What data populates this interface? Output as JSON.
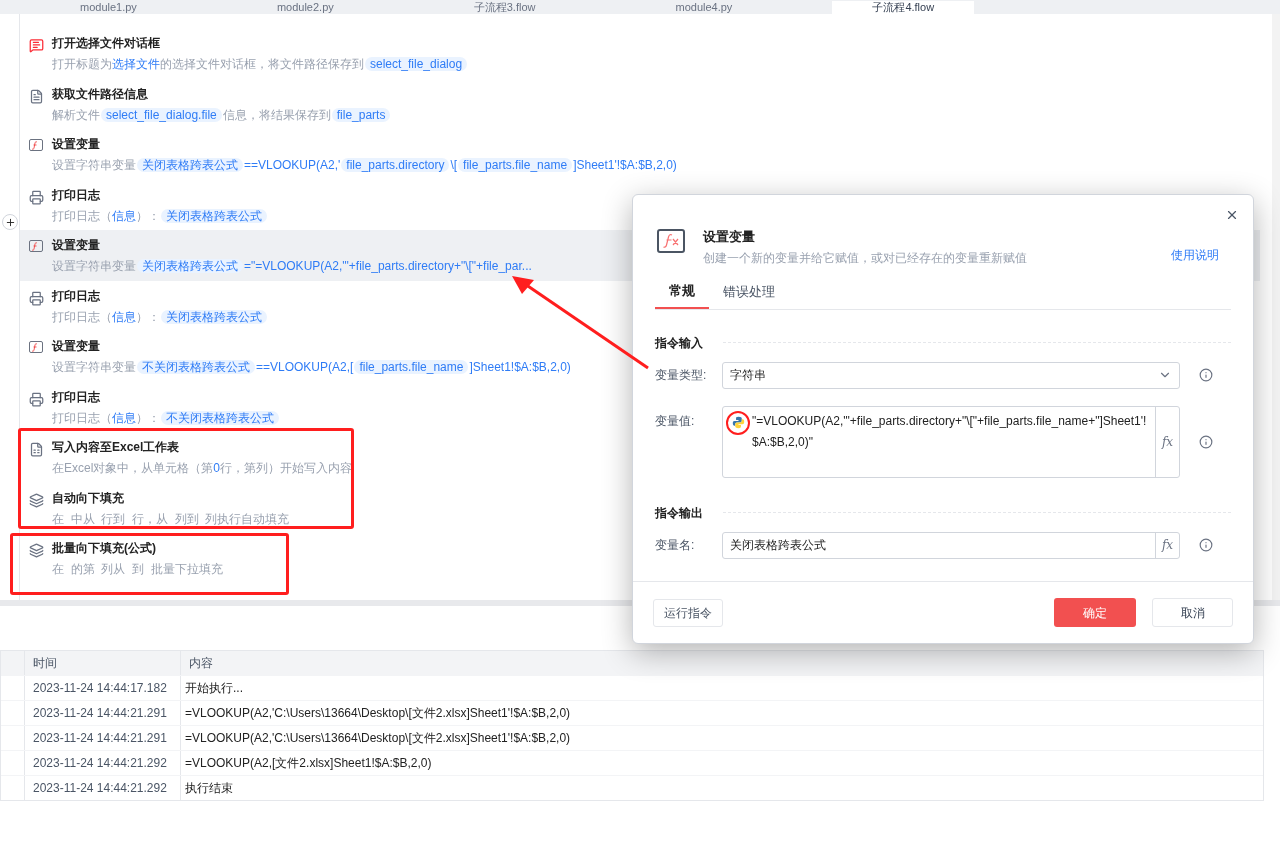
{
  "tabs": [
    {
      "label": "module1.py",
      "selected": false
    },
    {
      "label": "module2.py",
      "selected": false
    },
    {
      "label": "子流程3.flow",
      "selected": false
    },
    {
      "label": "module4.py",
      "selected": false
    },
    {
      "label": "子流程4.flow",
      "selected": true
    }
  ],
  "steps": [
    {
      "kind": "dialog",
      "title": "打开选择文件对话框",
      "selected": false,
      "desc": [
        {
          "kind": "text",
          "text": "打开标题为"
        },
        {
          "kind": "link",
          "text": "选择文件"
        },
        {
          "kind": "text",
          "text": "的选择文件对话框，将文件路径保存到"
        },
        {
          "kind": "chip",
          "text": "select_file_dialog"
        }
      ]
    },
    {
      "kind": "file",
      "title": "获取文件路径信息",
      "selected": false,
      "desc": [
        {
          "kind": "text",
          "text": "解析文件"
        },
        {
          "kind": "chip",
          "text": "select_file_dialog.file"
        },
        {
          "kind": "text",
          "text": "信息，将结果保存到"
        },
        {
          "kind": "chip",
          "text": "file_parts"
        }
      ]
    },
    {
      "kind": "fx",
      "title": "设置变量",
      "selected": false,
      "desc": [
        {
          "kind": "text",
          "text": "设置字符串变量"
        },
        {
          "kind": "chip",
          "text": "关闭表格跨表公式"
        },
        {
          "kind": "link",
          "text": "==VLOOKUP(A2,'"
        },
        {
          "kind": "chip",
          "text": "file_parts.directory"
        },
        {
          "kind": "link",
          "text": "\\["
        },
        {
          "kind": "chip",
          "text": "file_parts.file_name"
        },
        {
          "kind": "link",
          "text": "]Sheet1'!$A:$B,2,0)"
        }
      ]
    },
    {
      "kind": "print",
      "title": "打印日志",
      "selected": false,
      "desc": [
        {
          "kind": "text",
          "text": "打印日志（"
        },
        {
          "kind": "link",
          "text": "信息"
        },
        {
          "kind": "text",
          "text": "）："
        },
        {
          "kind": "chip",
          "text": "关闭表格跨表公式"
        }
      ]
    },
    {
      "kind": "fx",
      "title": "设置变量",
      "selected": true,
      "desc": [
        {
          "kind": "text",
          "text": "设置字符串变量"
        },
        {
          "kind": "chip",
          "text": "关闭表格跨表公式"
        },
        {
          "kind": "link",
          "text": "=\"=VLOOKUP(A2,'\"+file_parts.directory+\"\\[\"+file_par..."
        }
      ]
    },
    {
      "kind": "print",
      "title": "打印日志",
      "selected": false,
      "desc": [
        {
          "kind": "text",
          "text": "打印日志（"
        },
        {
          "kind": "link",
          "text": "信息"
        },
        {
          "kind": "text",
          "text": "）："
        },
        {
          "kind": "chip",
          "text": "关闭表格跨表公式"
        }
      ]
    },
    {
      "kind": "fx",
      "title": "设置变量",
      "selected": false,
      "desc": [
        {
          "kind": "text",
          "text": "设置字符串变量"
        },
        {
          "kind": "chip",
          "text": "不关闭表格跨表公式"
        },
        {
          "kind": "link",
          "text": "==VLOOKUP(A2,["
        },
        {
          "kind": "chip",
          "text": "file_parts.file_name"
        },
        {
          "kind": "link",
          "text": "]Sheet1!$A:$B,2,0)"
        }
      ]
    },
    {
      "kind": "print",
      "title": "打印日志",
      "selected": false,
      "desc": [
        {
          "kind": "text",
          "text": "打印日志（"
        },
        {
          "kind": "link",
          "text": "信息"
        },
        {
          "kind": "text",
          "text": "）："
        },
        {
          "kind": "chip",
          "text": "不关闭表格跨表公式"
        }
      ]
    },
    {
      "kind": "excel",
      "title": "写入内容至Excel工作表",
      "selected": false,
      "desc": [
        {
          "kind": "text",
          "text": "在Excel对象中，从单元格（第"
        },
        {
          "kind": "link",
          "text": "0"
        },
        {
          "kind": "text",
          "text": "行，第列）开始写入内容"
        }
      ]
    },
    {
      "kind": "layers",
      "title": "自动向下填充",
      "selected": false,
      "desc": [
        {
          "kind": "text",
          "text": "在  中从  行到  行，从  列到  列执行自动填充"
        }
      ]
    },
    {
      "kind": "layers",
      "title": "批量向下填充(公式)",
      "selected": false,
      "desc": [
        {
          "kind": "text",
          "text": "在  的第  列从  到  批量下拉填充"
        }
      ]
    }
  ],
  "log": {
    "columns": [
      "时间",
      "内容"
    ],
    "rows": [
      {
        "time": "2023-11-24 14:44:17.182",
        "content": "开始执行..."
      },
      {
        "time": "2023-11-24 14:44:21.291",
        "content": "=VLOOKUP(A2,'C:\\Users\\13664\\Desktop\\[文件2.xlsx]Sheet1'!$A:$B,2,0)"
      },
      {
        "time": "2023-11-24 14:44:21.291",
        "content": "=VLOOKUP(A2,'C:\\Users\\13664\\Desktop\\[文件2.xlsx]Sheet1'!$A:$B,2,0)"
      },
      {
        "time": "2023-11-24 14:44:21.292",
        "content": "=VLOOKUP(A2,[文件2.xlsx]Sheet1!$A:$B,2,0)"
      },
      {
        "time": "2023-11-24 14:44:21.292",
        "content": "执行结束"
      }
    ]
  },
  "dialog": {
    "title": "设置变量",
    "subtitle": "创建一个新的变量并给它赋值，或对已经存在的变量重新赋值",
    "help": "使用说明",
    "tabs": [
      {
        "label": "常规",
        "selected": true
      },
      {
        "label": "错误处理",
        "selected": false
      }
    ],
    "input_section": "指令输入",
    "type_label": "变量类型:",
    "type_value": "字符串",
    "value_label": "变量值:",
    "value": "\"=VLOOKUP(A2,'\"+file_parts.directory+\"\\[\"+file_parts.file_name+\"]Sheet1'!$A:$B,2,0)\"",
    "output_section": "指令输出",
    "name_label": "变量名:",
    "name_value": "关闭表格跨表公式",
    "fx_button": "fx",
    "run": "运行指令",
    "ok": "确定",
    "cancel": "取消"
  }
}
